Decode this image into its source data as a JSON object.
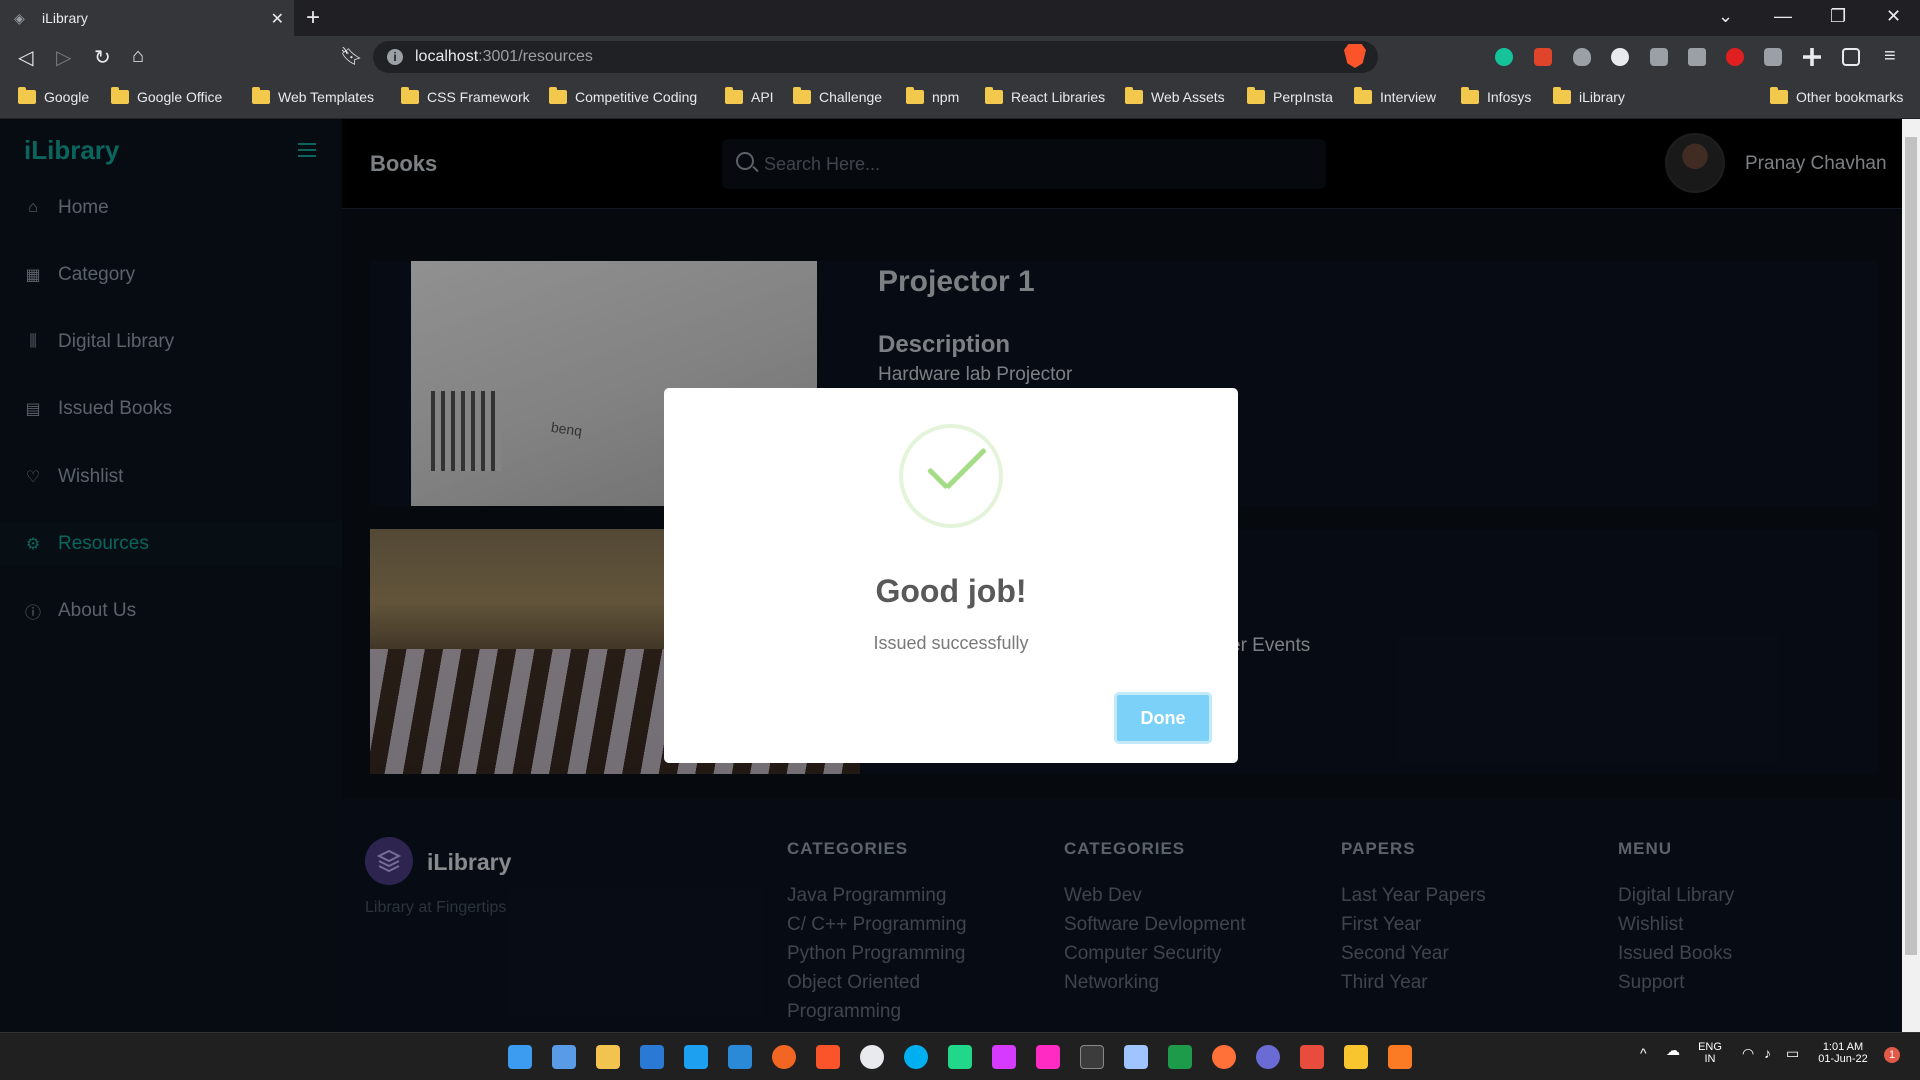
{
  "browser": {
    "tab_title": "iLibrary",
    "url_host": "localhost",
    "url_rest": ":3001/resources",
    "bookmarks": [
      "Google",
      "Google Office",
      "Web Templates",
      "CSS Framework",
      "Competitive Coding",
      "API",
      "Challenge",
      "npm",
      "React Libraries",
      "Web Assets",
      "PerpInsta",
      "Interview",
      "Infosys",
      "iLibrary"
    ],
    "other_bookmarks": "Other bookmarks"
  },
  "sidebar": {
    "brand": "iLibrary",
    "items": [
      {
        "label": "Home",
        "icon": "home-icon"
      },
      {
        "label": "Category",
        "icon": "grid-icon"
      },
      {
        "label": "Digital Library",
        "icon": "library-icon"
      },
      {
        "label": "Issued Books",
        "icon": "book-icon"
      },
      {
        "label": "Wishlist",
        "icon": "heart-icon"
      },
      {
        "label": "Resources",
        "icon": "gear-icon"
      },
      {
        "label": "About Us",
        "icon": "help-icon"
      }
    ],
    "active": "Resources"
  },
  "header": {
    "title": "Books",
    "search_placeholder": "Search Here...",
    "user_name": "Pranay Chavhan"
  },
  "resources": [
    {
      "title": "Projector 1",
      "subtitle": "Description",
      "description": "Hardware lab Projector"
    },
    {
      "partial_description": "er Events"
    }
  ],
  "footer": {
    "brand": "iLibrary",
    "tagline": "Library at Fingertips",
    "columns": [
      {
        "heading": "CATEGORIES",
        "links": [
          "Java Programming",
          "C/ C++ Programming",
          "Python Programming",
          "Object Oriented",
          "Programming"
        ]
      },
      {
        "heading": "CATEGORIES",
        "links": [
          "Web Dev",
          "Software Devlopment",
          "Computer Security",
          "Networking"
        ]
      },
      {
        "heading": "PAPERS",
        "links": [
          "Last Year Papers",
          "First Year",
          "Second Year",
          "Third Year"
        ]
      },
      {
        "heading": "MENU",
        "links": [
          "Digital Library",
          "Wishlist",
          "Issued Books",
          "Support"
        ]
      }
    ]
  },
  "modal": {
    "title": "Good job!",
    "text": "Issued successfully",
    "button": "Done",
    "icon": "success-check-icon",
    "success_color": "#a5dc86",
    "button_color": "#7cd1f9"
  },
  "taskbar": {
    "lang": "ENG",
    "region": "IN",
    "time": "1:01 AM",
    "date": "01-Jun-22",
    "notification_count": "1"
  },
  "colors": {
    "accent": "#14a89c",
    "sidebar_bg": "#0c1420",
    "page_bg": "#0b0f17"
  }
}
